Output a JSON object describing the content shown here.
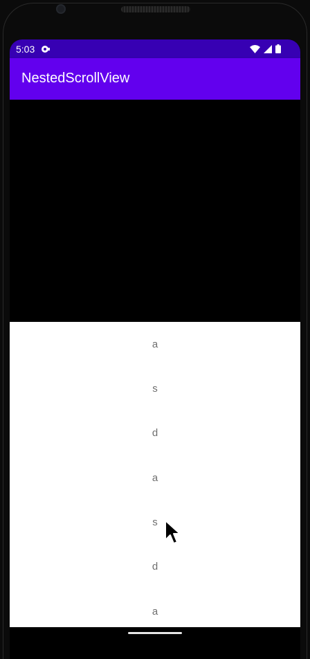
{
  "status_bar": {
    "time": "5:03",
    "background_color": "#3700b3",
    "icons": [
      "notification-icon",
      "wifi-icon",
      "cell-signal-icon",
      "battery-icon"
    ]
  },
  "app_bar": {
    "title": "NestedScrollView",
    "background_color": "#6200ee"
  },
  "nested_scroll": {
    "items": [
      "a",
      "s",
      "d",
      "a",
      "s",
      "d",
      "a"
    ]
  },
  "colors": {
    "header_area": "#000000",
    "list_background": "#ffffff",
    "list_text": "#6e6e6e"
  }
}
